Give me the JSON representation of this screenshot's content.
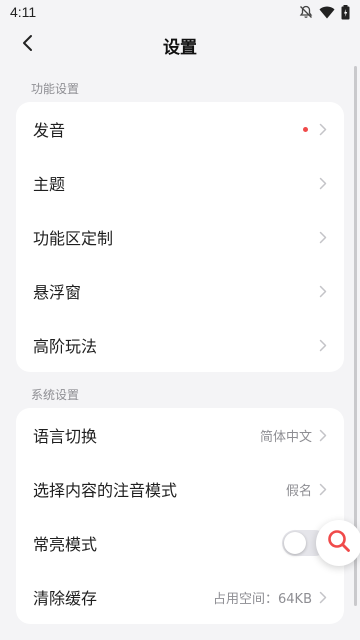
{
  "status_bar": {
    "time": "4:11",
    "icons": [
      "notifications-off-icon",
      "wifi-icon",
      "battery-icon"
    ]
  },
  "app_bar": {
    "title": "设置",
    "back_icon": "chevron-left-icon"
  },
  "sections": [
    {
      "header": "功能设置",
      "items": [
        {
          "label": "发音",
          "badge": "red-dot"
        },
        {
          "label": "主题"
        },
        {
          "label": "功能区定制"
        },
        {
          "label": "悬浮窗"
        },
        {
          "label": "高阶玩法"
        }
      ]
    },
    {
      "header": "系统设置",
      "items": [
        {
          "label": "语言切换",
          "value": "简体中文"
        },
        {
          "label": "选择内容的注音模式",
          "value": "假名"
        },
        {
          "label": "常亮模式",
          "toggle": false
        },
        {
          "label": "清除缓存",
          "value": "占用空间：64KB"
        }
      ]
    }
  ],
  "colors": {
    "background": "#f4f4f6",
    "card": "#ffffff",
    "badge": "#f04a4a",
    "float_accent": "#f04a4a"
  }
}
